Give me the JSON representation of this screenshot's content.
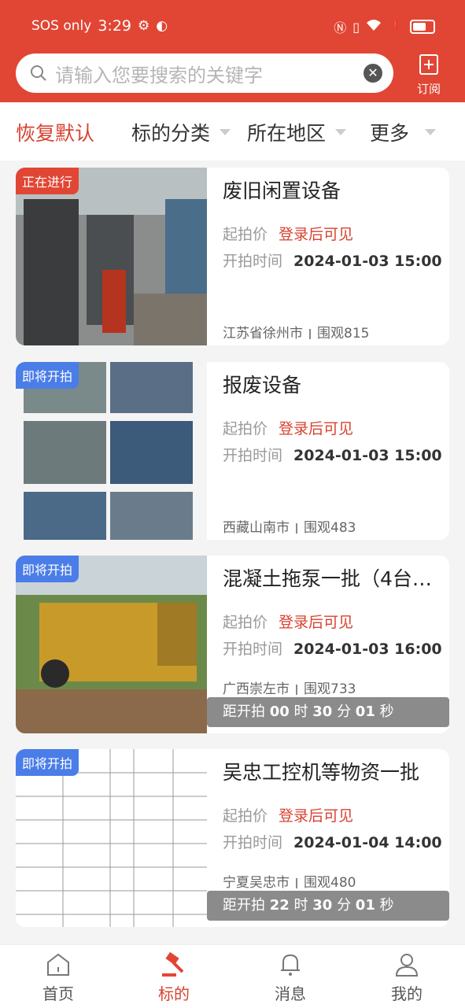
{
  "statusbar": {
    "left_text": "SOS only",
    "time": "3:29",
    "battery_pct": 0.7
  },
  "search": {
    "placeholder": "请输入您要搜索的关键字"
  },
  "subscribe": {
    "label": "订阅"
  },
  "filters": {
    "reset": "恢复默认",
    "category": "标的分类",
    "region": "所在地区",
    "more": "更多"
  },
  "labels": {
    "start_price": "起拍价",
    "start_time": "开拍时间",
    "views_prefix": "围观",
    "countdown_prefix": "距开拍",
    "hour": "时",
    "minute": "分",
    "second": "秒"
  },
  "listings": [
    {
      "badge": "正在进行",
      "badge_color": "#e14634",
      "title": "废旧闲置设备",
      "price": "登录后可见",
      "time": "2024-01-03 15:00",
      "location": "江苏省徐州市",
      "views": "815"
    },
    {
      "badge": "即将开拍",
      "badge_color": "#4a7de8",
      "title": "报废设备",
      "price": "登录后可见",
      "time": "2024-01-03 15:00",
      "location": "西藏山南市",
      "views": "483"
    },
    {
      "badge": "即将开拍",
      "badge_color": "#4a7de8",
      "title": "混凝土拖泵一批（4台…",
      "price": "登录后可见",
      "time": "2024-01-03 16:00",
      "location": "广西崇左市",
      "views": "733",
      "countdown": {
        "h": "00",
        "m": "30",
        "s": "01"
      }
    },
    {
      "badge": "即将开拍",
      "badge_color": "#4a7de8",
      "title": "吴忠工控机等物资一批",
      "price": "登录后可见",
      "time": "2024-01-04 14:00",
      "location": "宁夏吴忠市",
      "views": "480",
      "countdown": {
        "h": "22",
        "m": "30",
        "s": "01"
      }
    }
  ],
  "tabbar": {
    "home": "首页",
    "lots": "标的",
    "messages": "消息",
    "mine": "我的"
  },
  "colors": {
    "brand": "#e14634",
    "accent_text": "#d8422f"
  }
}
